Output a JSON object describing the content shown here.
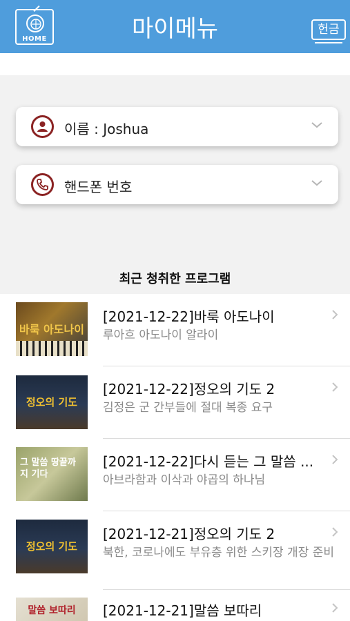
{
  "header": {
    "title": "마이메뉴",
    "home_label": "HOME",
    "donate_label": "헌금"
  },
  "profile": {
    "name_label": "이름 : Joshua",
    "phone_label": "핸드폰 번호"
  },
  "recent": {
    "section_title": "최근 청취한 프로그램",
    "items": [
      {
        "title": "[2021-12-22]바룩 아도나이",
        "subtitle": "루아흐 아도나이 알라이",
        "thumb_text": "바룩 아도나이"
      },
      {
        "title": "[2021-12-22]정오의 기도 2",
        "subtitle": "김정은 군 간부들에 절대 복종 요구",
        "thumb_text": "정오의 기도"
      },
      {
        "title": "[2021-12-22]다시 듣는 그 말씀 ...",
        "subtitle": "아브라함과 이삭과 야곱의 하나님",
        "thumb_text": "그 말씀 땅끝까지 기다"
      },
      {
        "title": "[2021-12-21]정오의 기도 2",
        "subtitle": "북한, 코로나에도 부유층 위한 스키장 개장 준비",
        "thumb_text": "정오의 기도"
      },
      {
        "title": "[2021-12-21]말씀 보따리",
        "subtitle": "",
        "thumb_text": "말씀 보따리"
      }
    ]
  },
  "colors": {
    "header_bg": "#4f9ddc",
    "icon_accent": "#8b2323"
  }
}
